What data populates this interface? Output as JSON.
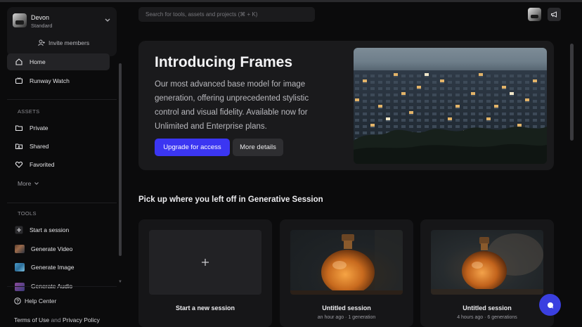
{
  "workspace": {
    "name": "Devon",
    "plan": "Standard",
    "invite_label": "Invite members"
  },
  "nav": [
    {
      "label": "Home",
      "icon": "home-icon",
      "active": true
    },
    {
      "label": "Runway Watch",
      "icon": "tv-icon",
      "active": false
    }
  ],
  "assets": {
    "heading": "ASSETS",
    "items": [
      {
        "label": "Private",
        "icon": "folder-icon"
      },
      {
        "label": "Shared",
        "icon": "shared-folder-icon"
      },
      {
        "label": "Favorited",
        "icon": "heart-icon"
      }
    ],
    "more_label": "More"
  },
  "tools": {
    "heading": "TOOLS",
    "items": [
      {
        "label": "Start a session",
        "icon": "plus-icon"
      },
      {
        "label": "Generate Video",
        "icon": "video-thumb"
      },
      {
        "label": "Generate Image",
        "icon": "image-thumb"
      },
      {
        "label": "Generate Audio",
        "icon": "audio-thumb"
      }
    ]
  },
  "footer": {
    "help": "Help Center",
    "terms": "Terms of Use",
    "and": "and",
    "privacy": "Privacy Policy"
  },
  "search": {
    "placeholder": "Search for tools, assets and projects (⌘ + K)"
  },
  "hero": {
    "title": "Introducing Frames",
    "description": "Our most advanced base model for image generation, offering unprecedented stylistic control and visual fidelity. Available now for Unlimited and Enterprise plans.",
    "primary_label": "Upgrade for access",
    "secondary_label": "More details"
  },
  "sessions": {
    "heading": "Pick up where you left off in Generative Session",
    "new_label": "Start a new session",
    "items": [
      {
        "title": "Untitled session",
        "meta": "an hour ago · 1 generation"
      },
      {
        "title": "Untitled session",
        "meta": "4 hours ago · 6 generations"
      }
    ]
  },
  "colors": {
    "accent": "#3b36f2",
    "background": "#0b0b0c",
    "panel": "#1a1a1c"
  }
}
